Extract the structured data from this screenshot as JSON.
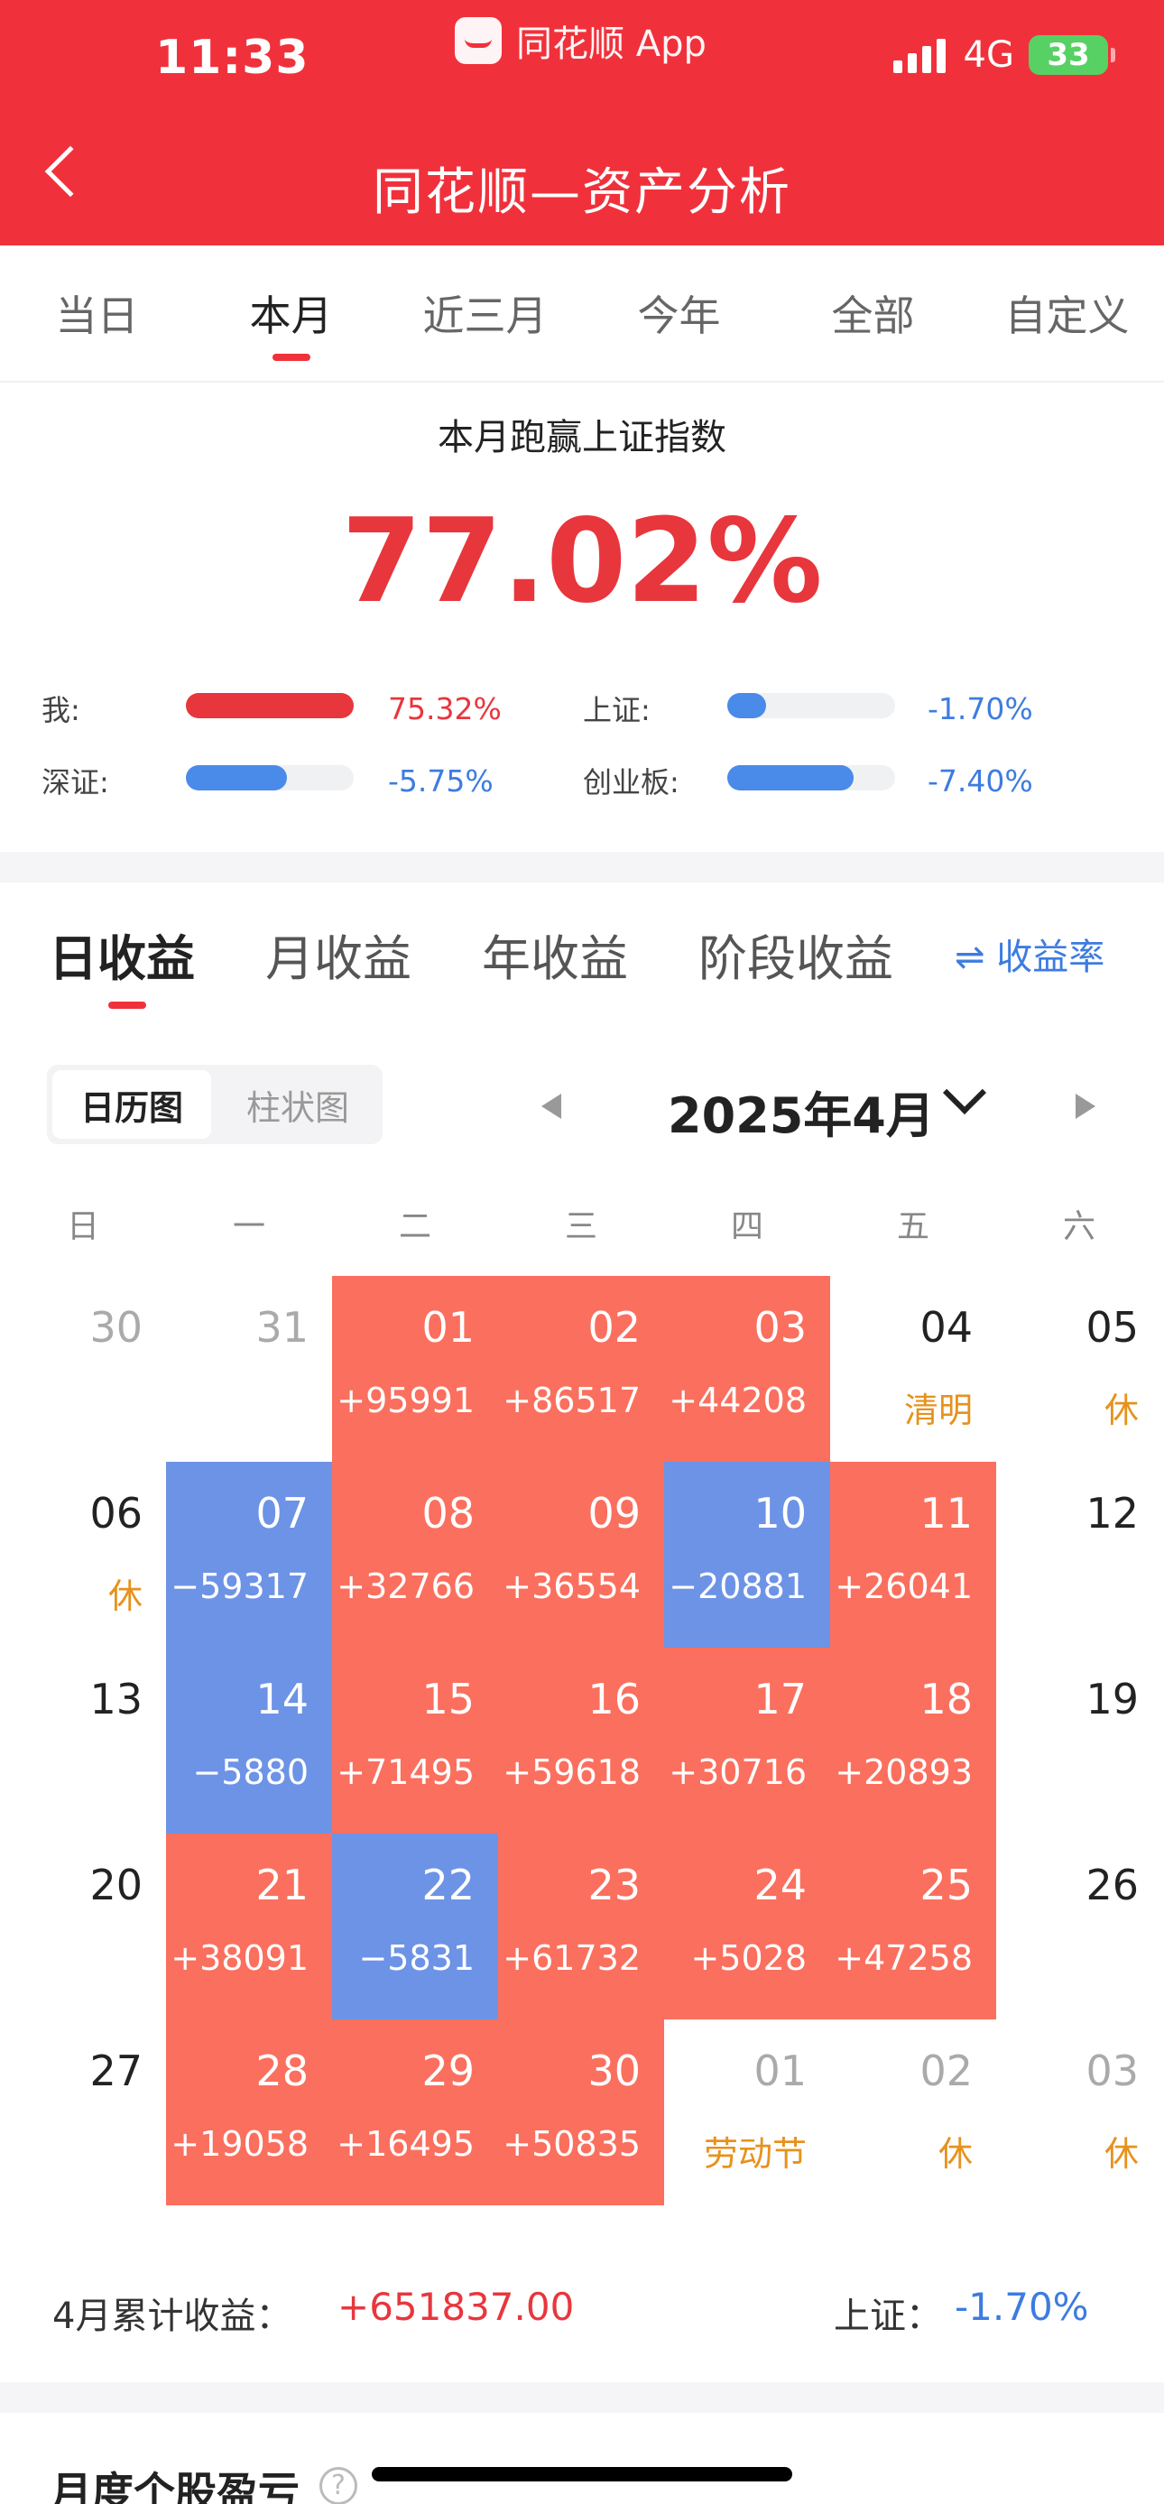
{
  "status": {
    "time": "11:33",
    "app": "同花顺 App",
    "network": "4G",
    "battery": "33"
  },
  "header": {
    "title": "同花顺—资产分析"
  },
  "period_tabs": [
    "当日",
    "本月",
    "近三月",
    "今年",
    "全部",
    "自定义"
  ],
  "period_active": "本月",
  "summary": {
    "label": "本月跑赢上证指数",
    "value": "77.02%",
    "comparisons": [
      {
        "label": "我:",
        "value": "75.32%",
        "fill": 1.0,
        "color": "#e8363d"
      },
      {
        "label": "上证:",
        "value": "-1.70%",
        "fill": 0.23,
        "color": "#4a8ae8"
      },
      {
        "label": "深证:",
        "value": "-5.75%",
        "fill": 0.6,
        "color": "#4a8ae8"
      },
      {
        "label": "创业板:",
        "value": "-7.40%",
        "fill": 0.75,
        "color": "#4a8ae8"
      }
    ]
  },
  "earn_tabs": [
    "日收益",
    "月收益",
    "年收益",
    "阶段收益"
  ],
  "earn_active": "日收益",
  "rate_toggle": "收益率",
  "view_toggle": [
    "日历图",
    "柱状图"
  ],
  "view_active": "日历图",
  "month_label": "2025年4月",
  "weekdays": [
    "日",
    "一",
    "二",
    "三",
    "四",
    "五",
    "六"
  ],
  "calendar": [
    [
      {
        "d": "30",
        "type": "dim"
      },
      {
        "d": "31",
        "type": "dim"
      },
      {
        "d": "01",
        "type": "gain",
        "v": "+95991"
      },
      {
        "d": "02",
        "type": "gain",
        "v": "+86517"
      },
      {
        "d": "03",
        "type": "gain",
        "v": "+44208"
      },
      {
        "d": "04",
        "type": "plain",
        "h": "清明"
      },
      {
        "d": "05",
        "type": "plain",
        "h": "休"
      }
    ],
    [
      {
        "d": "06",
        "type": "plain",
        "h": "休"
      },
      {
        "d": "07",
        "type": "loss",
        "v": "−59317"
      },
      {
        "d": "08",
        "type": "gain",
        "v": "+32766"
      },
      {
        "d": "09",
        "type": "gain",
        "v": "+36554"
      },
      {
        "d": "10",
        "type": "loss",
        "v": "−20881"
      },
      {
        "d": "11",
        "type": "gain",
        "v": "+26041"
      },
      {
        "d": "12",
        "type": "plain"
      }
    ],
    [
      {
        "d": "13",
        "type": "plain"
      },
      {
        "d": "14",
        "type": "loss",
        "v": "−5880"
      },
      {
        "d": "15",
        "type": "gain",
        "v": "+71495"
      },
      {
        "d": "16",
        "type": "gain",
        "v": "+59618"
      },
      {
        "d": "17",
        "type": "gain",
        "v": "+30716"
      },
      {
        "d": "18",
        "type": "gain",
        "v": "+20893"
      },
      {
        "d": "19",
        "type": "plain"
      }
    ],
    [
      {
        "d": "20",
        "type": "plain"
      },
      {
        "d": "21",
        "type": "gain",
        "v": "+38091"
      },
      {
        "d": "22",
        "type": "loss",
        "v": "−5831"
      },
      {
        "d": "23",
        "type": "gain",
        "v": "+61732"
      },
      {
        "d": "24",
        "type": "gain",
        "v": "+5028"
      },
      {
        "d": "25",
        "type": "gain",
        "v": "+47258"
      },
      {
        "d": "26",
        "type": "plain"
      }
    ],
    [
      {
        "d": "27",
        "type": "plain"
      },
      {
        "d": "28",
        "type": "gain",
        "v": "+19058"
      },
      {
        "d": "29",
        "type": "gain",
        "v": "+16495"
      },
      {
        "d": "30",
        "type": "gain",
        "v": "+50835"
      },
      {
        "d": "01",
        "type": "dim",
        "h": "劳动节"
      },
      {
        "d": "02",
        "type": "dim",
        "h": "休"
      },
      {
        "d": "03",
        "type": "dim",
        "h": "休"
      }
    ]
  ],
  "totals": {
    "label": "4月累计收益：",
    "value": "+651837.00",
    "index_label": "上证：",
    "index_value": "-1.70%"
  },
  "bottom_section": {
    "title": "月度个股盈亏",
    "help": "?"
  },
  "colors": {
    "brand": "#f0313b",
    "gain": "#fb6f5e",
    "loss": "#6d93e6",
    "holiday": "#e6921e"
  }
}
